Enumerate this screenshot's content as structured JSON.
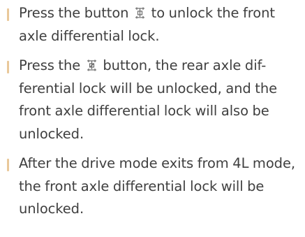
{
  "instructions": {
    "items": [
      {
        "text_before": "Press the button",
        "icon": "front-differential-lock-icon",
        "text_after": "to unlock the front axle differential lock."
      },
      {
        "text_before": "Press the",
        "icon": "rear-differential-lock-icon",
        "text_after": "button, the rear axle dif-ferential lock will be unlocked, and the front axle differential lock will also be unlocked."
      },
      {
        "text": "After the drive mode exits from 4L mode, the front axle differential lock will be unlocked."
      }
    ]
  },
  "colors": {
    "text": "#3f3f3f",
    "bullet": "#e9c89a",
    "icon": "#6a6a6a"
  }
}
